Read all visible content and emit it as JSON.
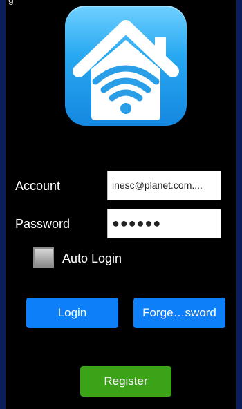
{
  "status_bar": {
    "glyph": "g"
  },
  "app_icon": {
    "name": "home-wifi-app-icon",
    "colors": {
      "gradient_top": "#6fd0ff",
      "gradient_bottom": "#1588e0",
      "house": "#ffffff",
      "wifi": "#2a9fe8"
    }
  },
  "login_form": {
    "account_label": "Account",
    "account_value": "inesc@planet.com....",
    "password_label": "Password",
    "password_value": "●●●●●●",
    "auto_login_label": "Auto Login",
    "auto_login_checked": false
  },
  "buttons": {
    "login": "Login",
    "forgot_password": "Forge…sword",
    "register": "Register"
  },
  "colors": {
    "background": "#000000",
    "outer_border": "#0b1d5a",
    "primary_button": "#0d7ff8",
    "register_button": "#3aa318"
  }
}
